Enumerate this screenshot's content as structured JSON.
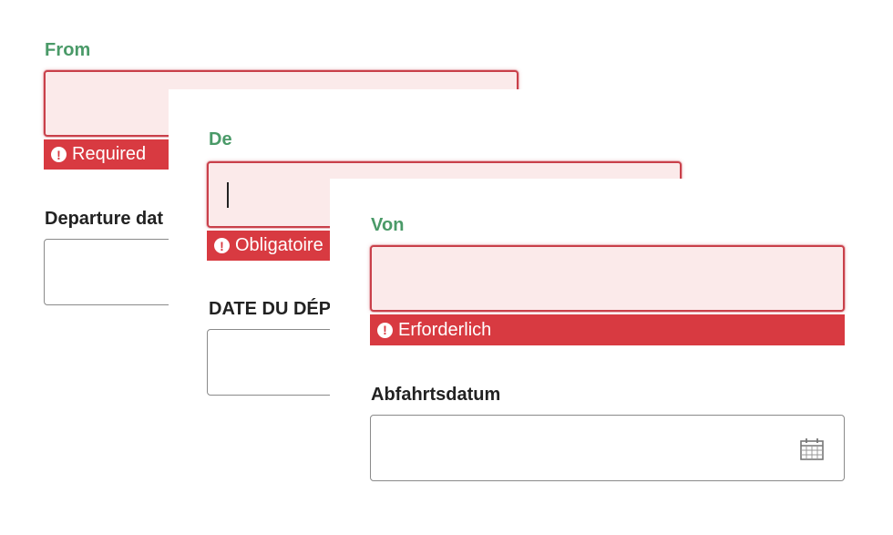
{
  "screens": [
    {
      "language": "en",
      "from_label": "From",
      "from_value": "",
      "error_text": "Required",
      "departure_label": "Departure dat",
      "departure_value": ""
    },
    {
      "language": "fr",
      "from_label": "De",
      "from_value": "",
      "error_text": "Obligatoire",
      "departure_label": "DATE DU DÉP",
      "departure_value": ""
    },
    {
      "language": "de",
      "from_label": "Von",
      "from_value": "",
      "error_text": "Erforderlich",
      "departure_label": "Abfahrtsdatum",
      "departure_value": ""
    }
  ],
  "icons": {
    "error": "exclamation-circle-icon",
    "date": "calendar-icon"
  },
  "colors": {
    "label_green": "#4a9a68",
    "error_red": "#d83a41",
    "error_field_bg": "#fbeaea",
    "field_border": "#8a8a8a"
  }
}
